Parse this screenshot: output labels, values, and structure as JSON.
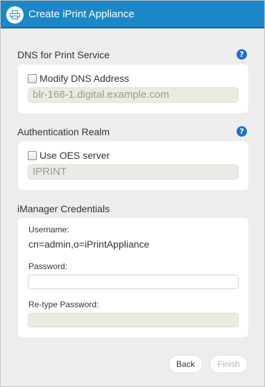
{
  "dialog": {
    "title": "Create iPrint Appliance",
    "title_icon": "printer-icon"
  },
  "dns_section": {
    "heading": "DNS for Print Service",
    "help": "?",
    "checkbox_label": "Modify DNS Address",
    "checkbox_checked": false,
    "value": "blr-168-1.digital.example.com"
  },
  "auth_section": {
    "heading": "Authentication Realm",
    "help": "?",
    "checkbox_label": "Use OES server",
    "checkbox_checked": false,
    "value": "IPRINT"
  },
  "credentials_section": {
    "heading": "iManager Credentials",
    "username_label": "Username:",
    "username_value": "cn=admin,o=iPrintAppliance",
    "password_label": "Password:",
    "password_value": "",
    "retype_label": "Re-type Password:",
    "retype_value": ""
  },
  "buttons": {
    "back": "Back",
    "finish": "Finish"
  },
  "colors": {
    "titlebar": "#1b87c9",
    "help_icon": "#1e6fc9",
    "background": "#ededed"
  }
}
